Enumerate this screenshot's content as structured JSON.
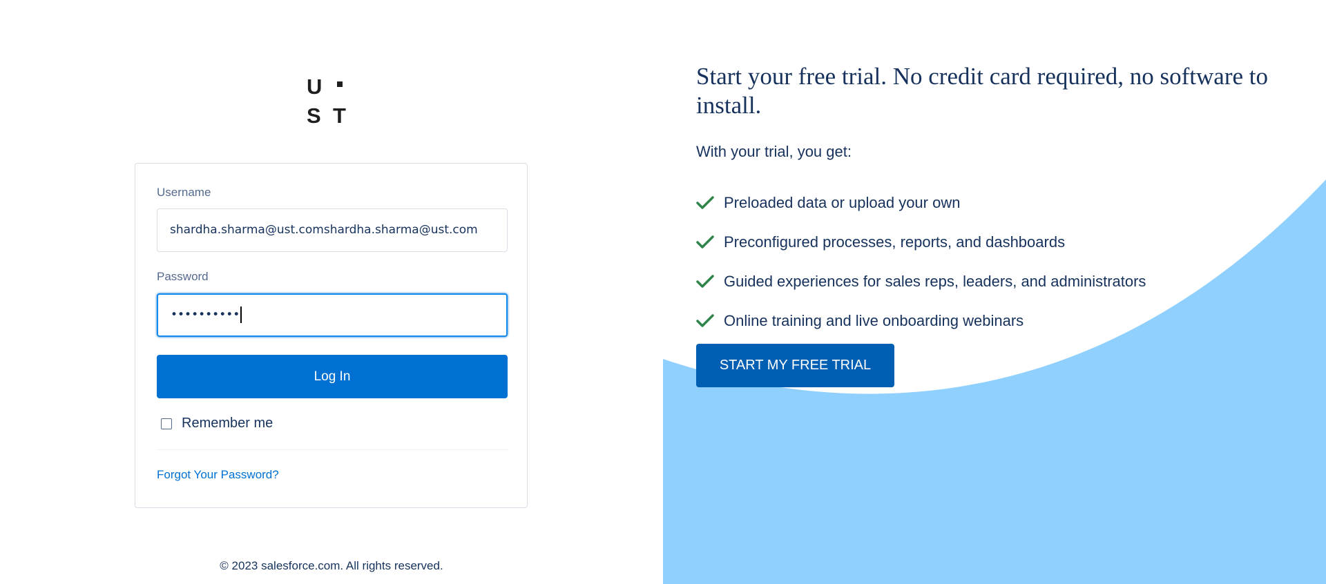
{
  "brand": {
    "logo_letters": [
      "U",
      "S",
      "T"
    ],
    "accent_color": "#0070d2",
    "hero_color": "#90d0fe"
  },
  "login": {
    "username_label": "Username",
    "username_value": "shardha.sharma@ust.comshardha.sharma@ust.com",
    "password_label": "Password",
    "password_value": "••••••••••",
    "login_button": "Log In",
    "remember_label": "Remember me",
    "remember_checked": false,
    "forgot_link": "Forgot Your Password?"
  },
  "footer": {
    "copyright": "© 2023 salesforce.com. All rights reserved."
  },
  "promo": {
    "headline": "Start your free trial. No credit card required, no software to install.",
    "subheading": "With your trial, you get:",
    "benefits": [
      "Preloaded data or upload your own",
      "Preconfigured processes, reports, and dashboards",
      "Guided experiences for sales reps, leaders, and administrators",
      "Online training and live onboarding webinars"
    ],
    "cta_button": "START MY FREE TRIAL",
    "check_icon": "checkmark-icon",
    "check_color": "#2e844a"
  }
}
